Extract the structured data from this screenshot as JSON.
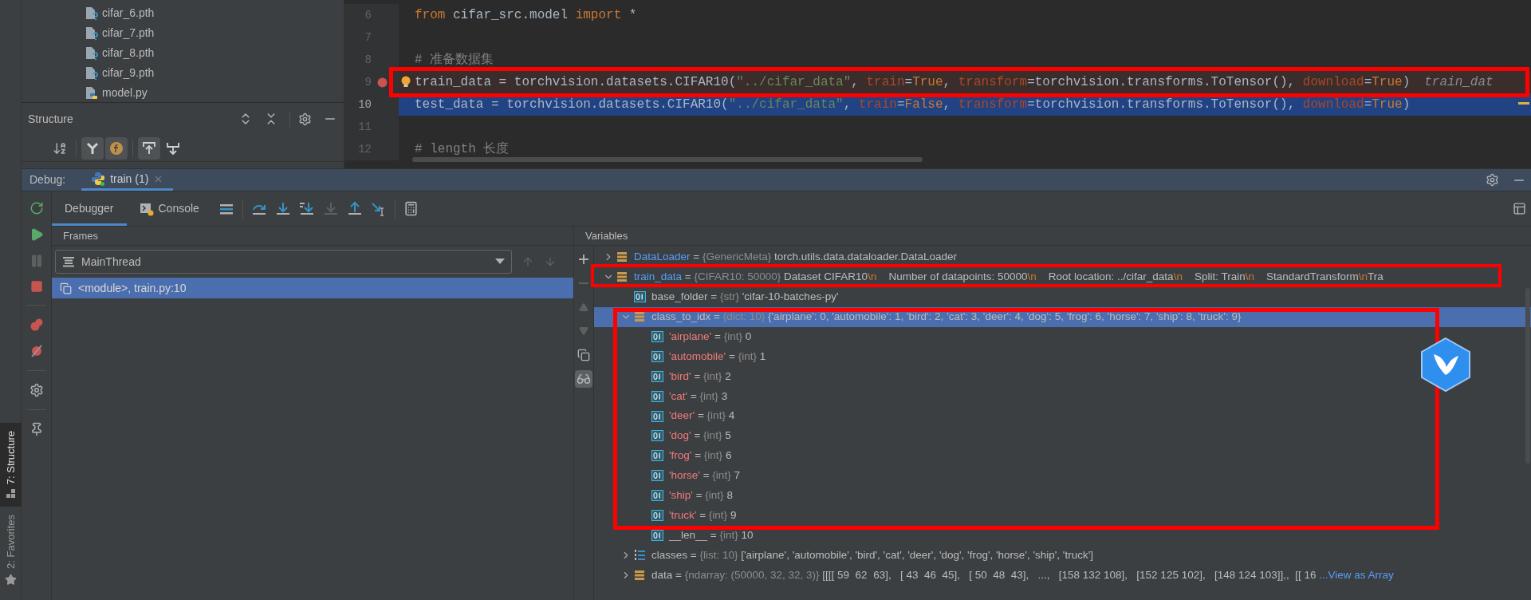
{
  "project_tree": {
    "files": [
      {
        "name": "cifar_6.pth",
        "kind": "unknown"
      },
      {
        "name": "cifar_7.pth",
        "kind": "unknown"
      },
      {
        "name": "cifar_8.pth",
        "kind": "unknown"
      },
      {
        "name": "cifar_9.pth",
        "kind": "unknown"
      },
      {
        "name": "model.py",
        "kind": "python"
      }
    ]
  },
  "structure": {
    "title": "Structure",
    "toolbar": [
      {
        "kind": "sort",
        "on": false
      },
      {
        "kind": "inherited",
        "on": true
      },
      {
        "kind": "fields",
        "on": true
      },
      {
        "kind": "anchor_up",
        "on": true
      },
      {
        "kind": "anchor_down",
        "on": false
      }
    ]
  },
  "editor": {
    "lines": [
      {
        "number": "6",
        "breakpoint": false,
        "current": false,
        "bulb": false,
        "tokens": [
          {
            "text": "from",
            "kind": "keyword"
          },
          {
            "text": " cifar_src.model ",
            "kind": "plain"
          },
          {
            "text": "import",
            "kind": "keyword"
          },
          {
            "text": " *",
            "kind": "plain"
          }
        ]
      },
      {
        "number": "7",
        "breakpoint": false,
        "current": false,
        "bulb": false
      },
      {
        "number": "8",
        "breakpoint": false,
        "current": false,
        "bulb": false,
        "tokens": [
          {
            "text": "# 准备数据集",
            "kind": "comment"
          }
        ]
      },
      {
        "number": "9",
        "breakpoint": true,
        "current": false,
        "bulb": true,
        "hint": "train_dat",
        "tokens": [
          {
            "text": "train_data = torchvision.datasets.CIFAR10(",
            "kind": "plain"
          },
          {
            "text": "\"../cifar_data\"",
            "kind": "string"
          },
          {
            "text": ", ",
            "kind": "plain"
          },
          {
            "text": "train",
            "kind": "param"
          },
          {
            "text": "=",
            "kind": "plain"
          },
          {
            "text": "True",
            "kind": "keyword"
          },
          {
            "text": ", ",
            "kind": "plain"
          },
          {
            "text": "transform",
            "kind": "param"
          },
          {
            "text": "=torchvision.transforms.ToTensor(), ",
            "kind": "plain"
          },
          {
            "text": "download",
            "kind": "param"
          },
          {
            "text": "=",
            "kind": "plain"
          },
          {
            "text": "True",
            "kind": "keyword"
          },
          {
            "text": ")",
            "kind": "plain"
          }
        ]
      },
      {
        "number": "10",
        "breakpoint": false,
        "current": true,
        "bulb": false,
        "tokens": [
          {
            "text": "test_data = torchvision.datasets.CIFAR10(",
            "kind": "plain"
          },
          {
            "text": "\"../cifar_data\"",
            "kind": "string"
          },
          {
            "text": ", ",
            "kind": "plain"
          },
          {
            "text": "train",
            "kind": "param"
          },
          {
            "text": "=",
            "kind": "plain"
          },
          {
            "text": "False",
            "kind": "keyword"
          },
          {
            "text": ", ",
            "kind": "plain"
          },
          {
            "text": "transform",
            "kind": "param"
          },
          {
            "text": "=torchvision.transforms.ToTensor(), ",
            "kind": "plain"
          },
          {
            "text": "download",
            "kind": "param"
          },
          {
            "text": "=",
            "kind": "plain"
          },
          {
            "text": "True",
            "kind": "keyword"
          },
          {
            "text": ")",
            "kind": "plain"
          }
        ]
      },
      {
        "number": "11",
        "breakpoint": false,
        "current": false,
        "bulb": false
      },
      {
        "number": "12",
        "breakpoint": false,
        "current": false,
        "bulb": false,
        "tokens": [
          {
            "text": "# length 长度",
            "kind": "comment"
          }
        ]
      }
    ]
  },
  "side_tabs": [
    {
      "label": "7: Structure",
      "kind": "structure",
      "selected": true
    },
    {
      "label": "2: Favorites",
      "kind": "favorites",
      "selected": false
    }
  ],
  "debug": {
    "label": "Debug:",
    "tabs": [
      {
        "label": "train (1)",
        "selected": true
      }
    ],
    "controls": [
      {
        "kind": "rerun",
        "disabled": false
      },
      {
        "kind": "resume",
        "disabled": false
      },
      {
        "kind": "pause",
        "disabled": true
      },
      {
        "kind": "stop",
        "disabled": false
      },
      {
        "kind": "breakpoints",
        "disabled": false
      },
      {
        "kind": "mute",
        "disabled": false
      },
      {
        "kind": "settings",
        "disabled": false
      },
      {
        "kind": "pin",
        "disabled": false
      }
    ],
    "views": [
      {
        "label": "Debugger",
        "kind": "debugger",
        "selected": true
      },
      {
        "label": "Console",
        "kind": "console",
        "selected": false
      }
    ],
    "actions": [
      {
        "kind": "execution_point",
        "disabled": false
      },
      {
        "kind": "step_over",
        "disabled": false
      },
      {
        "kind": "step_into",
        "disabled": false
      },
      {
        "kind": "step_into_my_code",
        "disabled": false
      },
      {
        "kind": "force_step_into",
        "disabled": true
      },
      {
        "kind": "step_out",
        "disabled": false
      },
      {
        "kind": "run_to_cursor",
        "disabled": false
      },
      {
        "kind": "evaluate",
        "disabled": false
      }
    ]
  },
  "frames": {
    "title": "Frames",
    "thread": "MainThread",
    "items": [
      {
        "label": "<module>, train.py:10",
        "selected": true
      }
    ]
  },
  "variables": {
    "title": "Variables",
    "toolbar": [
      {
        "kind": "add",
        "disabled": false,
        "on": false
      },
      {
        "kind": "remove",
        "disabled": true,
        "on": false
      },
      {
        "kind": "up",
        "disabled": true,
        "on": false
      },
      {
        "kind": "down",
        "disabled": true,
        "on": false
      },
      {
        "kind": "copy",
        "disabled": false,
        "on": false
      },
      {
        "kind": "watches",
        "disabled": false,
        "on": true
      }
    ],
    "rows": [
      {
        "name": "DataLoader",
        "color": "#589df6",
        "kind": "object",
        "separator": "=",
        "type": "{GenericMeta}",
        "value": "torch.utils.data.dataloader.DataLoader",
        "expanded": false,
        "selected": false
      },
      {
        "name": "train_data",
        "color": "#589df6",
        "kind": "object",
        "separator": "=",
        "type": "{CIFAR10: 50000}",
        "value_parts": [
          {
            "text": "Dataset CIFAR10",
            "kind": "plain"
          },
          {
            "text": "\\n",
            "kind": "escape"
          },
          {
            "text": "    Number of datapoints: 50000",
            "kind": "plain"
          },
          {
            "text": "\\n",
            "kind": "escape"
          },
          {
            "text": "    Root location: ../cifar_data",
            "kind": "plain"
          },
          {
            "text": "\\n",
            "kind": "escape"
          },
          {
            "text": "    Split: Train",
            "kind": "plain"
          },
          {
            "text": "\\n",
            "kind": "escape"
          },
          {
            "text": "    StandardTransform",
            "kind": "plain"
          },
          {
            "text": "\\n",
            "kind": "escape"
          },
          {
            "text": "Tra",
            "kind": "plain"
          }
        ],
        "expanded": true,
        "selected": false,
        "children": [
          {
            "name": "base_folder",
            "color": "#bbbbbb",
            "kind": "scalar",
            "separator": "=",
            "type": "{str}",
            "value": "'cifar-10-batches-py'",
            "selected": false
          },
          {
            "name": "class_to_idx",
            "color": "#bbbbbb",
            "kind": "object",
            "separator": "=",
            "type": "{dict: 10}",
            "value": "{'airplane': 0, 'automobile': 1, 'bird': 2, 'cat': 3, 'deer': 4, 'dog': 5, 'frog': 6, 'horse': 7, 'ship': 8, 'truck': 9}",
            "expanded": true,
            "selected": true,
            "children": [
              {
                "name": "'airplane'",
                "color": "#f07a7a",
                "kind": "scalar",
                "separator": "=",
                "type": "{int}",
                "value": "0",
                "selected": false
              },
              {
                "name": "'automobile'",
                "color": "#f07a7a",
                "kind": "scalar",
                "separator": "=",
                "type": "{int}",
                "value": "1",
                "selected": false
              },
              {
                "name": "'bird'",
                "color": "#f07a7a",
                "kind": "scalar",
                "separator": "=",
                "type": "{int}",
                "value": "2",
                "selected": false
              },
              {
                "name": "'cat'",
                "color": "#f07a7a",
                "kind": "scalar",
                "separator": "=",
                "type": "{int}",
                "value": "3",
                "selected": false
              },
              {
                "name": "'deer'",
                "color": "#f07a7a",
                "kind": "scalar",
                "separator": "=",
                "type": "{int}",
                "value": "4",
                "selected": false
              },
              {
                "name": "'dog'",
                "color": "#f07a7a",
                "kind": "scalar",
                "separator": "=",
                "type": "{int}",
                "value": "5",
                "selected": false
              },
              {
                "name": "'frog'",
                "color": "#f07a7a",
                "kind": "scalar",
                "separator": "=",
                "type": "{int}",
                "value": "6",
                "selected": false
              },
              {
                "name": "'horse'",
                "color": "#f07a7a",
                "kind": "scalar",
                "separator": "=",
                "type": "{int}",
                "value": "7",
                "selected": false
              },
              {
                "name": "'ship'",
                "color": "#f07a7a",
                "kind": "scalar",
                "separator": "=",
                "type": "{int}",
                "value": "8",
                "selected": false
              },
              {
                "name": "'truck'",
                "color": "#f07a7a",
                "kind": "scalar",
                "separator": "=",
                "type": "{int}",
                "value": "9",
                "selected": false
              },
              {
                "name": "__len__",
                "color": "#bbbbbb",
                "kind": "scalar",
                "separator": "=",
                "type": "{int}",
                "value": "10",
                "selected": false
              }
            ]
          },
          {
            "name": "classes",
            "color": "#bbbbbb",
            "kind": "list",
            "separator": "=",
            "type": "{list: 10}",
            "value": "['airplane', 'automobile', 'bird', 'cat', 'deer', 'dog', 'frog', 'horse', 'ship', 'truck']",
            "expanded": false,
            "selected": false
          },
          {
            "name": "data",
            "color": "#bbbbbb",
            "kind": "object",
            "separator": "=",
            "type": "{ndarray: (50000, 32, 32, 3)}",
            "value": "[[[[ 59  62  63],   [ 43  46  45],   [ 50  48  43],   ...,   [158 132 108],   [152 125 102],   [148 124 103]],,  [[ 16 ",
            "link": "...View as Array",
            "expanded": false,
            "selected": false
          }
        ]
      }
    ]
  }
}
